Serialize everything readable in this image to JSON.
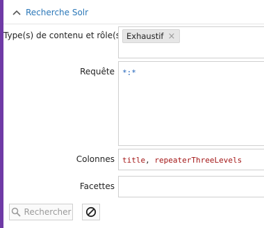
{
  "header": {
    "title": "Recherche Solr"
  },
  "form": {
    "content_types_label": "Type(s) de contenu et rôle(s)",
    "content_tag": "Exhaustif",
    "query_label": "Requête",
    "query_value": "*:*",
    "columns_label": "Colonnes",
    "columns_value_1": "title",
    "columns_sep": ", ",
    "columns_value_2": "repeaterThreeLevels",
    "facets_label": "Facettes",
    "facets_value": ""
  },
  "buttons": {
    "search_label": "Rechercher"
  },
  "colors": {
    "accent": "#2a77b8",
    "side_bar": "#6f3aa6",
    "code_blue": "#1b5fb8",
    "code_red": "#a31515"
  }
}
